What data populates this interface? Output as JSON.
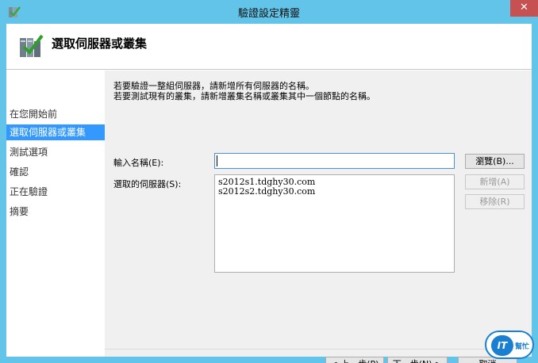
{
  "window": {
    "title": "驗證設定精靈",
    "close_label": "✕"
  },
  "header": {
    "title": "選取伺服器或叢集"
  },
  "nav": {
    "items": [
      {
        "label": "在您開始前"
      },
      {
        "label": "選取伺服器或叢集"
      },
      {
        "label": "測試選項"
      },
      {
        "label": "確認"
      },
      {
        "label": "正在驗證"
      },
      {
        "label": "摘要"
      }
    ],
    "active_index": 1
  },
  "content": {
    "desc_line1": "若要驗證一整組伺服器，請新增所有伺服器的名稱。",
    "desc_line2": "若要測試現有的叢集，請新增叢集名稱或叢集其中一個節點的名稱。",
    "name_label": "輸入名稱(E):",
    "name_value": "",
    "selected_label": "選取的伺服器(S):",
    "servers": [
      "s2012s1.tdghy30.com",
      "s2012s2.tdghy30.com"
    ],
    "browse_label": "瀏覽(B)...",
    "add_label": "新增(A)",
    "remove_label": "移除(R)"
  },
  "footer": {
    "back_label": "< 上一步(P)",
    "next_label": "下一步(N) >",
    "cancel_label": "取消"
  },
  "watermark": {
    "logo": "IT",
    "text": "幫忙"
  },
  "colors": {
    "frame": "#62c4e8",
    "selection": "#3399ff",
    "close": "#c75050"
  }
}
